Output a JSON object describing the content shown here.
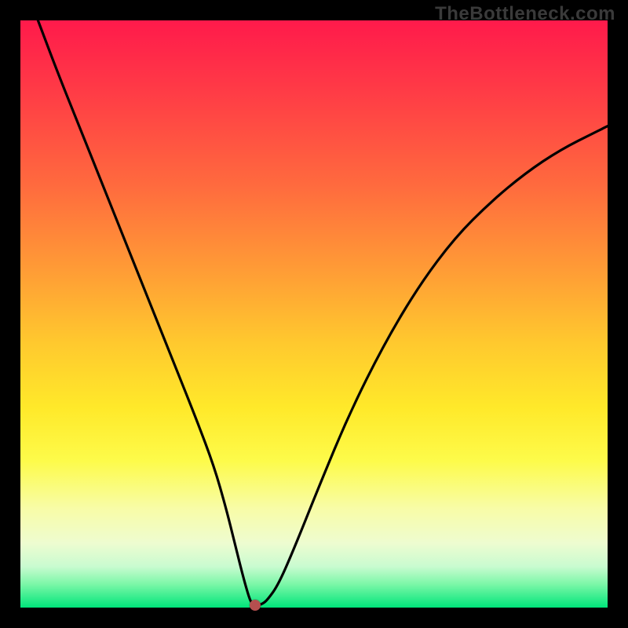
{
  "watermark": "TheBottleneck.com",
  "chart_data": {
    "type": "line",
    "title": "",
    "xlabel": "",
    "ylabel": "",
    "xlim": [
      0,
      100
    ],
    "ylim": [
      0,
      100
    ],
    "grid": false,
    "series": [
      {
        "name": "curve",
        "color": "#000000",
        "x": [
          3,
          6,
          10,
          14,
          18,
          22,
          26,
          30,
          33,
          35,
          36.5,
          38,
          39,
          39.5,
          40,
          41,
          42,
          44,
          47,
          51,
          56,
          62,
          68,
          74,
          80,
          86,
          92,
          98,
          100
        ],
        "y": [
          100,
          92,
          82,
          72,
          62,
          52,
          42,
          32,
          24,
          17,
          11,
          5,
          1.5,
          0.6,
          0.4,
          0.5,
          1.2,
          4,
          11,
          21,
          33,
          45,
          55,
          63,
          69,
          74,
          78,
          81,
          82
        ]
      }
    ],
    "marker": {
      "x": 40,
      "y": 0.4,
      "color": "#b54f4f"
    },
    "background_gradient": {
      "direction": "vertical",
      "stops": [
        {
          "pct": 0,
          "color": "#ff1a4b"
        },
        {
          "pct": 28,
          "color": "#ff6a3e"
        },
        {
          "pct": 55,
          "color": "#ffc92e"
        },
        {
          "pct": 75,
          "color": "#fdfb4a"
        },
        {
          "pct": 93,
          "color": "#c9fbd0"
        },
        {
          "pct": 100,
          "color": "#00e57a"
        }
      ]
    }
  }
}
